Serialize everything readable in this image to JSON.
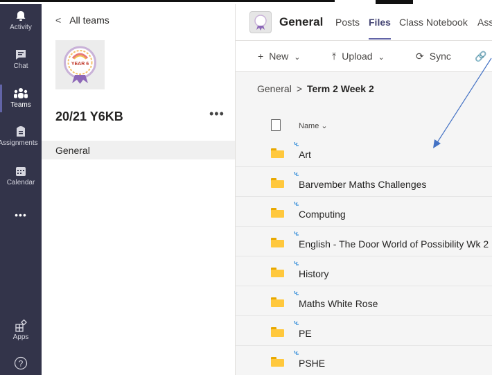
{
  "rail": {
    "items": [
      {
        "label": "Activity",
        "icon": "bell-icon"
      },
      {
        "label": "Chat",
        "icon": "chat-icon"
      },
      {
        "label": "Teams",
        "icon": "teams-icon"
      },
      {
        "label": "Assignments",
        "icon": "assignments-icon"
      },
      {
        "label": "Calendar",
        "icon": "calendar-icon"
      },
      {
        "label": "Apps",
        "icon": "apps-icon"
      }
    ],
    "more": "•••",
    "help": "?"
  },
  "team_panel": {
    "back_label": "All teams",
    "team_name": "20/21 Y6KB",
    "more": "•••",
    "channel": "General",
    "badge_text": "YEAR 6"
  },
  "header": {
    "channel_title": "General",
    "tabs": [
      "Posts",
      "Files",
      "Class Notebook",
      "Ass"
    ]
  },
  "toolbar": {
    "new_label": "New",
    "upload_label": "Upload",
    "sync_label": "Sync"
  },
  "breadcrumb": {
    "root": "General",
    "current": "Term 2 Week 2"
  },
  "list": {
    "column_name": "Name",
    "folders": [
      "Art",
      "Barvember Maths Challenges",
      "Computing",
      "English - The Door World of Possibility Wk 2",
      "History",
      "Maths White Rose",
      "PE",
      "PSHE"
    ]
  },
  "colors": {
    "rail_bg": "#33344a",
    "accent": "#6264a7",
    "folder": "#ffc83d",
    "annotation_arrow": "#4472c4"
  }
}
